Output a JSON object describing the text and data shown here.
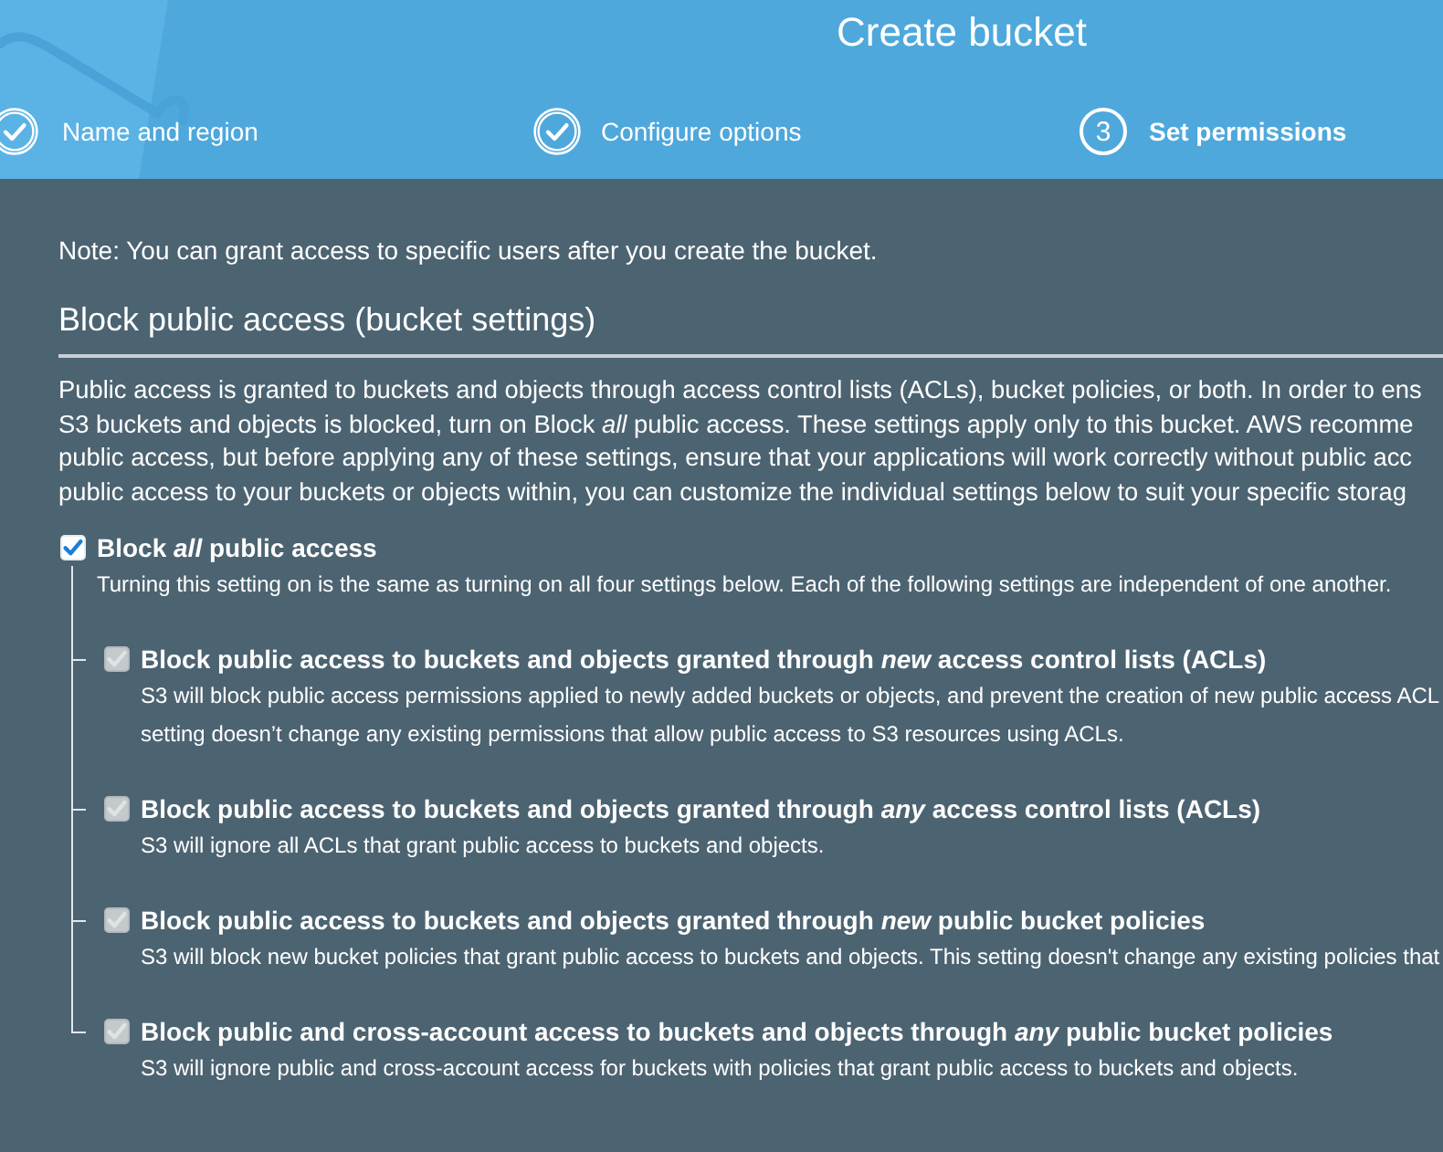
{
  "header": {
    "title": "Create bucket",
    "steps": [
      {
        "label": "Name and region",
        "completed": true,
        "selected": false
      },
      {
        "label": "Configure options",
        "completed": true,
        "selected": false
      },
      {
        "number": "3",
        "label": "Set permissions",
        "completed": false,
        "selected": true
      }
    ]
  },
  "note": "Note: You can grant access to specific users after you create the bucket.",
  "section": {
    "heading": "Block public access (bucket settings)",
    "intro_lines": [
      "Public access is granted to buckets and objects through access control lists (ACLs), bucket policies, or both. In order to ens",
      "S3 buckets and objects is blocked, turn on Block *all* public access. These settings apply only to this bucket. AWS recomme",
      "public access, but before applying any of these settings, ensure that your applications will work correctly without public acc",
      "public access to your buckets or objects within, you can customize the individual settings below to suit your specific storag"
    ],
    "block_all": {
      "label": "Block *all* public access",
      "checked": true,
      "disabled": false,
      "description": "Turning this setting on is the same as turning on all four settings below. Each of the following settings are independent of one another."
    },
    "settings": [
      {
        "label": "Block public access to buckets and objects granted through *new* access control lists (ACLs)",
        "checked": true,
        "disabled": true,
        "description_lines": [
          "S3 will block public access permissions applied to newly added buckets or objects, and prevent the creation of new public access ACL",
          "setting doesn’t change any existing permissions that allow public access to S3 resources using ACLs."
        ]
      },
      {
        "label": "Block public access to buckets and objects granted through *any* access control lists (ACLs)",
        "checked": true,
        "disabled": true,
        "description_lines": [
          "S3 will ignore all ACLs that grant public access to buckets and objects."
        ]
      },
      {
        "label": "Block public access to buckets and objects granted through *new* public bucket policies",
        "checked": true,
        "disabled": true,
        "description_lines": [
          "S3 will block new bucket policies that grant public access to buckets and objects. This setting doesn't change any existing policies that"
        ]
      },
      {
        "label": "Block public and cross-account access to buckets and objects through *any* public bucket policies",
        "checked": true,
        "disabled": true,
        "description_lines": [
          "S3 will ignore public and cross-account access for buckets with policies that grant public access to buckets and objects."
        ]
      }
    ]
  }
}
